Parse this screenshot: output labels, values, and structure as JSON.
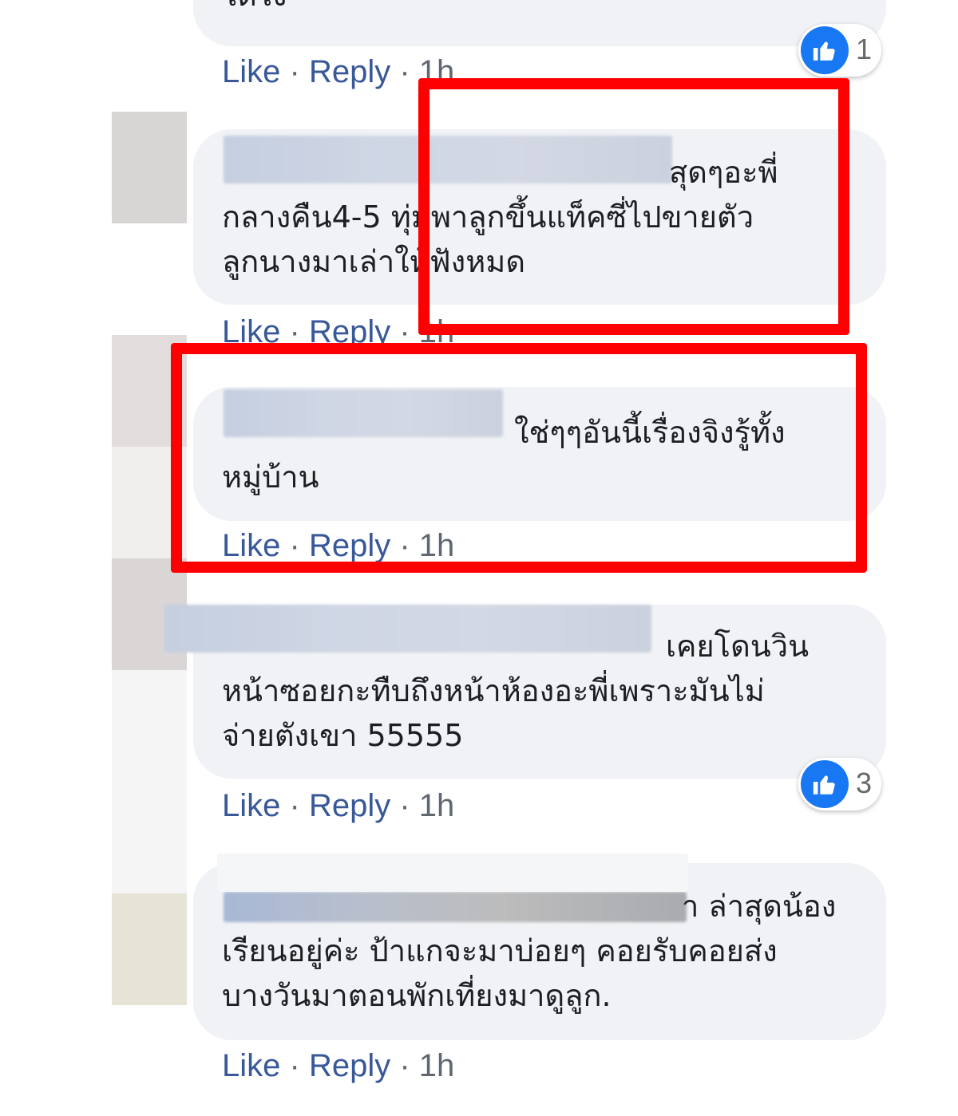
{
  "actions": {
    "like": "Like",
    "reply": "Reply",
    "separator": " · ",
    "time": "1h"
  },
  "reactions": [
    {
      "icon": "thumbs-up-icon",
      "count": "1"
    },
    {
      "icon": "thumbs-up-icon",
      "count": "3"
    }
  ],
  "comments": [
    {
      "text": "ได้ไง"
    },
    {
      "text": "สุดๆอะพี่\nกลางคืน4-5 ทุ่มพาลูกขึ้นแท็คซี่ไปขายตัว\nลูกนางมาเล่าให้ฟังหมด"
    },
    {
      "text": "ใช่ๆๆอันนี้เรื่องจิงรู้ทั้ง\nหมู่บ้าน"
    },
    {
      "text": "เคยโดนวิน\nหน้าซอยกะทืบถึงหน้าห้องอะพี่เพราะมันไม่\nจ่ายตังเขา 55555"
    },
    {
      "text": "า ล่าสุดน้อง\nเรียนอยู่ค่ะ ป้าแกจะมาบ่อยๆ คอยรับคอยส่ง\nบางวันมาตอนพักเที่ยงมาดูลูก."
    }
  ],
  "colors": {
    "link": "#385898",
    "meta": "#606770",
    "bubble": "#f0f2f5",
    "highlight": "#ff0000",
    "like_blue": "#1877f2"
  }
}
